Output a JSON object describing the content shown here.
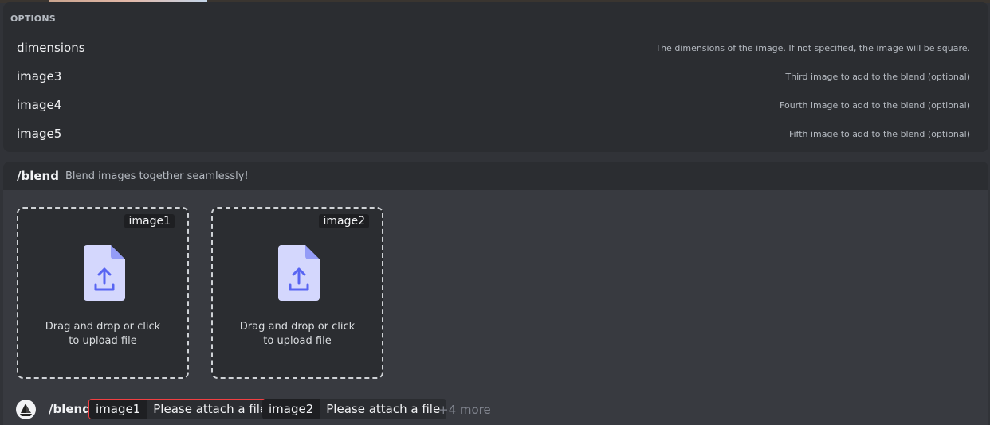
{
  "options": {
    "title": "OPTIONS",
    "items": [
      {
        "name": "dimensions",
        "description": "The dimensions of the image. If not specified, the image will be square."
      },
      {
        "name": "image3",
        "description": "Third image to add to the blend (optional)"
      },
      {
        "name": "image4",
        "description": "Fourth image to add to the blend (optional)"
      },
      {
        "name": "image5",
        "description": "Fifth image to add to the blend (optional)"
      }
    ]
  },
  "command": {
    "name": "/blend",
    "description": "Blend images together seamlessly!"
  },
  "dropzones": [
    {
      "tag": "image1",
      "hint": "Drag and drop or click to upload file",
      "icon": "file-upload-icon"
    },
    {
      "tag": "image2",
      "hint": "Drag and drop or click to upload file",
      "icon": "file-upload-icon"
    }
  ],
  "input": {
    "command": "/blend",
    "chips": [
      {
        "key": "image1",
        "value": "Please attach a file",
        "error": true
      },
      {
        "key": "image2",
        "value": "Please attach a file",
        "error": false
      }
    ],
    "more": "+4 more"
  },
  "colors": {
    "accent": "#5865f2",
    "error": "#f23f42",
    "file_icon": "#d4d7fd"
  }
}
